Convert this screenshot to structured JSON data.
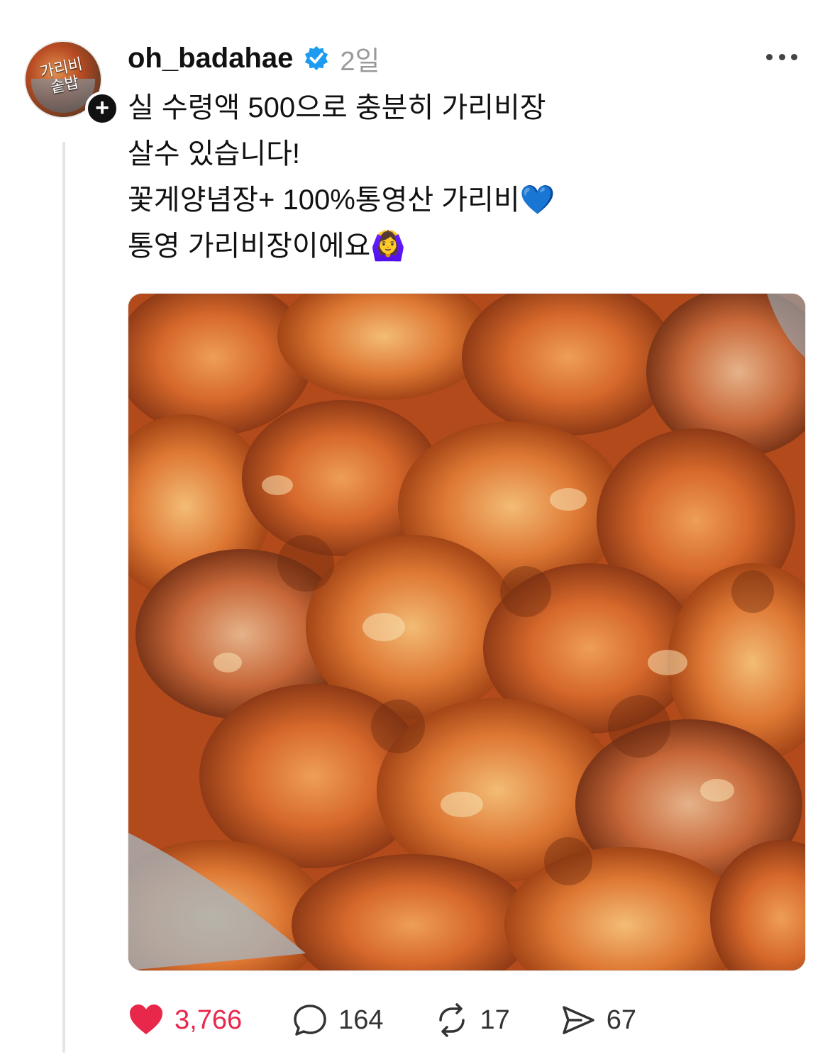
{
  "post": {
    "avatar_text": "가리비 솥밥",
    "username": "oh_badahae",
    "time": "2일",
    "text_lines": [
      "실 수령액 500으로 충분히 가리비장",
      "살수 있습니다!",
      "꽃게양념장+ 100%통영산 가리비💙",
      "통영 가리비장이에요🙆‍♀️"
    ],
    "media_description_icon": "photo"
  },
  "actions": {
    "likes": "3,766",
    "comments": "164",
    "reposts": "17",
    "shares": "67"
  },
  "colors": {
    "like_red": "#e8274b",
    "verified_blue": "#1d9bf0",
    "thread_line": "#e4e4e4"
  },
  "icons": {
    "verified": "verified-badge-icon",
    "like": "heart-icon",
    "comment": "comment-bubble-icon",
    "repost": "repost-icon",
    "share": "send-icon",
    "more": "more-dots-icon",
    "follow": "plus-icon"
  }
}
